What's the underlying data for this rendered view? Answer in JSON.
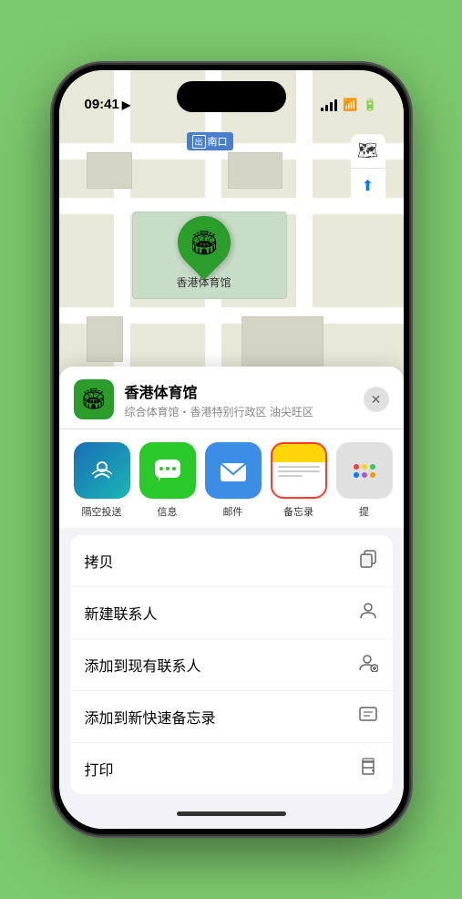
{
  "status": {
    "time": "09:41",
    "location_icon": "▶"
  },
  "map": {
    "label": "南口",
    "venue_pin_label": "香港体育馆"
  },
  "map_controls": {
    "map_icon": "🗺",
    "location_icon": "➤"
  },
  "sheet": {
    "venue_name": "香港体育馆",
    "venue_desc": "综合体育馆・香港特别行政区 油尖旺区",
    "close_label": "✕"
  },
  "share_items": [
    {
      "id": "airdrop",
      "label": "隔空投送"
    },
    {
      "id": "messages",
      "label": "信息"
    },
    {
      "id": "mail",
      "label": "邮件"
    },
    {
      "id": "notes",
      "label": "备忘录"
    },
    {
      "id": "more",
      "label": "提"
    }
  ],
  "actions": [
    {
      "label": "拷贝",
      "icon": "⧉"
    },
    {
      "label": "新建联系人",
      "icon": "👤"
    },
    {
      "label": "添加到现有联系人",
      "icon": "👤+"
    },
    {
      "label": "添加到新快速备忘录",
      "icon": "📝"
    },
    {
      "label": "打印",
      "icon": "🖨"
    }
  ]
}
